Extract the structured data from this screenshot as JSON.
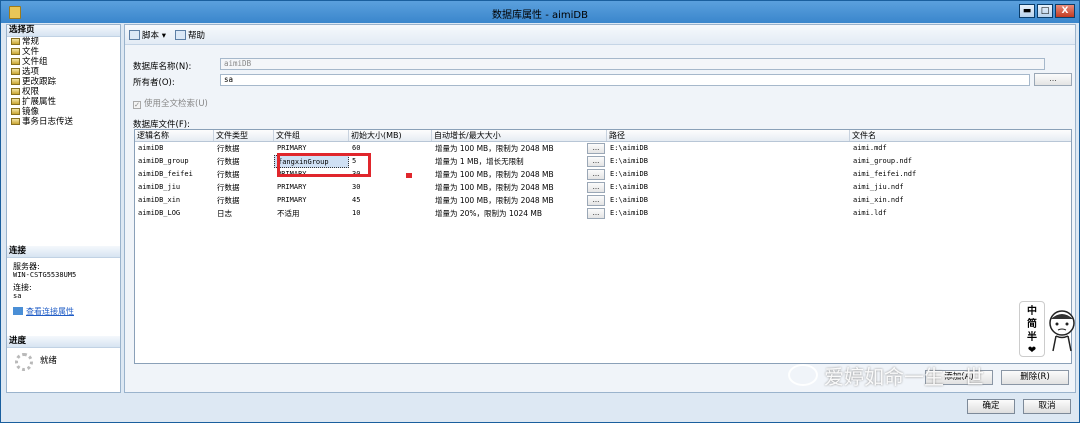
{
  "window": {
    "title": "数据库属性 - aimiDB",
    "min": "▬",
    "max": "□",
    "close": "X"
  },
  "left": {
    "select_page_header": "选择页",
    "pages": [
      "常规",
      "文件",
      "文件组",
      "选项",
      "更改跟踪",
      "权限",
      "扩展属性",
      "镜像",
      "事务日志传送"
    ],
    "connection_header": "连接",
    "server_label": "服务器:",
    "server_value": "WIN-CSTG5538UM5",
    "conn_label": "连接:",
    "conn_value": "sa",
    "view_conn_link": "查看连接属性",
    "progress_header": "进度",
    "status": "就绪"
  },
  "toolbar": {
    "script_label": "脚本",
    "help_label": "帮助"
  },
  "form": {
    "db_name_label": "数据库名称(N):",
    "db_name_value": "aimiDB",
    "owner_label": "所有者(O):",
    "owner_value": "sa",
    "owner_browse": "...",
    "fulltext_label": "使用全文检索(U)",
    "fulltext_checked": true,
    "files_label": "数据库文件(F):"
  },
  "grid": {
    "columns": [
      "逻辑名称",
      "文件类型",
      "文件组",
      "初始大小(MB)",
      "自动增长/最大大小",
      "路径",
      "文件名"
    ],
    "rows": [
      {
        "logical": "aimiDB",
        "type": "行数据",
        "group": "PRIMARY",
        "size": "60",
        "growth": "增量为 100 MB，限制为 2048 MB",
        "path": "E:\\aimiDB",
        "file": "aimi.mdf"
      },
      {
        "logical": "aimiDB_group",
        "type": "行数据",
        "group": "fangxinGroup",
        "size": "5",
        "growth": "增量为 1 MB，增长无限制",
        "path": "E:\\aimiDB",
        "file": "aimi_group.ndf"
      },
      {
        "logical": "aimiDB_feifei",
        "type": "行数据",
        "group": "PRIMARY",
        "size": "30",
        "growth": "增量为 100 MB，限制为 2048 MB",
        "path": "E:\\aimiDB",
        "file": "aimi_feifei.ndf"
      },
      {
        "logical": "aimiDB_jiu",
        "type": "行数据",
        "group": "PRIMARY",
        "size": "30",
        "growth": "增量为 100 MB，限制为 2048 MB",
        "path": "E:\\aimiDB",
        "file": "aimi_jiu.ndf"
      },
      {
        "logical": "aimiDB_xin",
        "type": "行数据",
        "group": "PRIMARY",
        "size": "45",
        "growth": "增量为 100 MB，限制为 2048 MB",
        "path": "E:\\aimiDB",
        "file": "aimi_xin.ndf"
      },
      {
        "logical": "aimiDB_LOG",
        "type": "日志",
        "group": "不适用",
        "size": "10",
        "growth": "增量为 20%，限制为 1024 MB",
        "path": "E:\\aimiDB",
        "file": "aimi.ldf"
      }
    ],
    "ellipsis": "..."
  },
  "buttons": {
    "add": "添加(A)",
    "remove": "删除(R)",
    "ok": "确定",
    "cancel": "取消"
  },
  "watermark": {
    "text": "爱婷如命一生一世",
    "badge": [
      "中",
      "简",
      "半",
      "❤"
    ]
  }
}
